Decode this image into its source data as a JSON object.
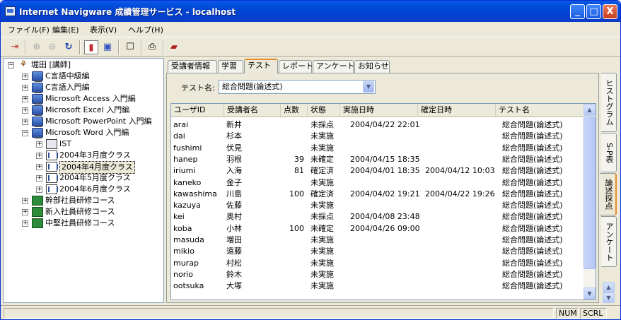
{
  "window": {
    "title": "Internet Navigware 成績管理サービス - localhost",
    "controls": {
      "minimize": "_",
      "maximize": "□",
      "close": "X"
    }
  },
  "menu": [
    "ファイル(F)",
    "編集(E)",
    "表示(V)",
    "ヘルプ(H)"
  ],
  "toolbar": {
    "icons": [
      "exit-icon",
      "zoom-in-icon",
      "zoom-out-icon",
      "refresh-icon",
      "view-toggle-1-icon",
      "view-toggle-2-icon",
      "user-card-icon",
      "print-icon",
      "book-icon"
    ],
    "glyphs": [
      "⇥",
      "⊕",
      "⊖",
      "↻",
      "▮",
      "▣",
      "☐",
      "⎙",
      "▰"
    ]
  },
  "tree": {
    "root": "堀田 [講師]",
    "items": [
      {
        "label": "C言語中級編",
        "level": 1,
        "type": "pc",
        "expander": "+"
      },
      {
        "label": "C言語入門編",
        "level": 1,
        "type": "pc",
        "expander": "+"
      },
      {
        "label": "Microsoft Access 入門編",
        "level": 1,
        "type": "pc",
        "expander": "+"
      },
      {
        "label": "Microsoft Excel 入門編",
        "level": 1,
        "type": "pc",
        "expander": "+"
      },
      {
        "label": "Microsoft PowerPoint 入門編",
        "level": 1,
        "type": "pc",
        "expander": "+"
      },
      {
        "label": "Microsoft Word 入門編",
        "level": 1,
        "type": "pc",
        "expander": "−"
      },
      {
        "label": "IST",
        "level": 2,
        "type": "id",
        "expander": "+"
      },
      {
        "label": "2004年3月度クラス",
        "level": 2,
        "type": "class",
        "expander": "+"
      },
      {
        "label": "2004年4月度クラス",
        "level": 2,
        "type": "class",
        "expander": "+",
        "selected": true
      },
      {
        "label": "2004年5月度クラス",
        "level": 2,
        "type": "class",
        "expander": "+"
      },
      {
        "label": "2004年6月度クラス",
        "level": 2,
        "type": "class",
        "expander": "+"
      },
      {
        "label": "幹部社員研修コース",
        "level": 1,
        "type": "course",
        "expander": "+"
      },
      {
        "label": "新入社員研修コース",
        "level": 1,
        "type": "course",
        "expander": "+"
      },
      {
        "label": "中堅社員研修コース",
        "level": 1,
        "type": "course",
        "expander": "+"
      }
    ],
    "root_expander": "−"
  },
  "tabs": [
    "受講者情報",
    "学習",
    "テスト",
    "レポート",
    "アンケート",
    "お知らせ"
  ],
  "active_tab": 2,
  "test_selector": {
    "label": "テスト名:",
    "value": "総合問題(論述式)"
  },
  "grid": {
    "columns": [
      "ユーザID",
      "受講者名",
      "点数",
      "状態",
      "実施日時",
      "確定日時",
      "テスト名"
    ],
    "rows": [
      [
        "arai",
        "新井",
        "",
        "未採点",
        "2004/04/22 22:01",
        "",
        "総合問題(論述式)"
      ],
      [
        "dai",
        "杉本",
        "",
        "未実施",
        "",
        "",
        "総合問題(論述式)"
      ],
      [
        "fushimi",
        "伏見",
        "",
        "未実施",
        "",
        "",
        "総合問題(論述式)"
      ],
      [
        "hanep",
        "羽根",
        "39",
        "未確定",
        "2004/04/15 18:35",
        "",
        "総合問題(論述式)"
      ],
      [
        "iriumi",
        "入海",
        "81",
        "確定済",
        "2004/04/01 18:35",
        "2004/04/12 10:03",
        "総合問題(論述式)"
      ],
      [
        "kaneko",
        "金子",
        "",
        "未実施",
        "",
        "",
        "総合問題(論述式)"
      ],
      [
        "kawashima",
        "川島",
        "100",
        "確定済",
        "2004/04/02 19:21",
        "2004/04/22 19:26",
        "総合問題(論述式)"
      ],
      [
        "kazuya",
        "佐藤",
        "",
        "未実施",
        "",
        "",
        "総合問題(論述式)"
      ],
      [
        "kei",
        "奥村",
        "",
        "未採点",
        "2004/04/08 23:48",
        "",
        "総合問題(論述式)"
      ],
      [
        "koba",
        "小林",
        "100",
        "未確定",
        "2004/04/26 09:00",
        "",
        "総合問題(論述式)"
      ],
      [
        "masuda",
        "増田",
        "",
        "未実施",
        "",
        "",
        "総合問題(論述式)"
      ],
      [
        "mikio",
        "遠藤",
        "",
        "未実施",
        "",
        "",
        "総合問題(論述式)"
      ],
      [
        "murap",
        "村松",
        "",
        "未実施",
        "",
        "",
        "総合問題(論述式)"
      ],
      [
        "norio",
        "鈴木",
        "",
        "未実施",
        "",
        "",
        "総合問題(論述式)"
      ],
      [
        "ootsuka",
        "大塚",
        "",
        "未実施",
        "",
        "",
        "総合問題(論述式)"
      ]
    ]
  },
  "side_tabs": [
    "ヒストグラム",
    "S-P表",
    "論述採点",
    "アンケート"
  ],
  "active_side_tab": 2,
  "status": {
    "num": "NUM",
    "scrl": "SCRL"
  }
}
